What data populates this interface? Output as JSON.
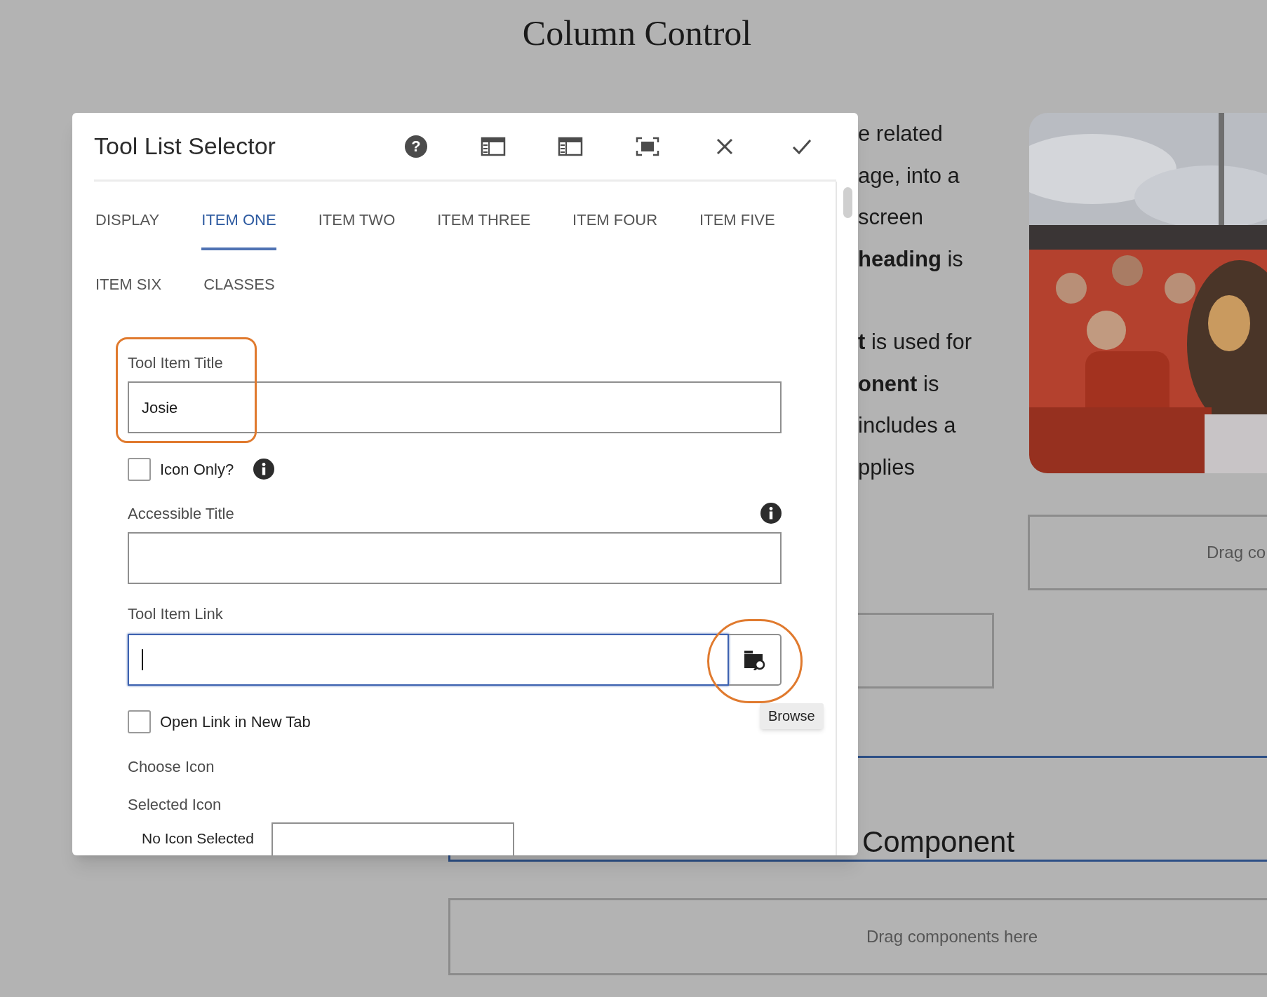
{
  "page_heading": "Column Control",
  "text_fragments": [
    {
      "lines": [
        "e related",
        "age, into a",
        "screen",
        "**heading** is"
      ]
    },
    {
      "lines": [
        "**t** is used for",
        "**onent** is",
        "includes a",
        "pplies"
      ]
    }
  ],
  "drop_zone_right": {
    "label": "Drag co"
  },
  "section_heading": "Component",
  "drop_zone_bottom": {
    "label": "Drag components here"
  },
  "dialog": {
    "title": "Tool List Selector",
    "help_label": "?",
    "tabs": [
      {
        "label": "DISPLAY",
        "selected": false
      },
      {
        "label": "ITEM ONE",
        "selected": true
      },
      {
        "label": "ITEM TWO",
        "selected": false
      },
      {
        "label": "ITEM THREE",
        "selected": false
      },
      {
        "label": "ITEM FOUR",
        "selected": false
      },
      {
        "label": "ITEM FIVE",
        "selected": false
      },
      {
        "label": "ITEM SIX",
        "selected": false
      },
      {
        "label": "CLASSES",
        "selected": false
      }
    ],
    "fields": [
      {
        "kind": "text_field",
        "label": "Tool Item Title",
        "value": "Josie",
        "highlighted": true,
        "info": false
      },
      {
        "kind": "checkbox",
        "label": "Icon Only?",
        "checked": false,
        "info": true
      },
      {
        "kind": "text_field",
        "label": "Accessible Title",
        "highlighted": false,
        "info": true
      },
      {
        "kind": "path_field",
        "label": "Tool Item Link",
        "focused": true,
        "browse_highlighted": true,
        "tooltip": "Browse"
      },
      {
        "kind": "checkbox",
        "label": "Open Link in New Tab",
        "checked": false,
        "info": false
      },
      {
        "kind": "heading",
        "label": "Choose Icon"
      },
      {
        "kind": "note",
        "label": "Selected Icon"
      },
      {
        "kind": "icon_picker",
        "label": "No Icon Selected"
      }
    ]
  }
}
